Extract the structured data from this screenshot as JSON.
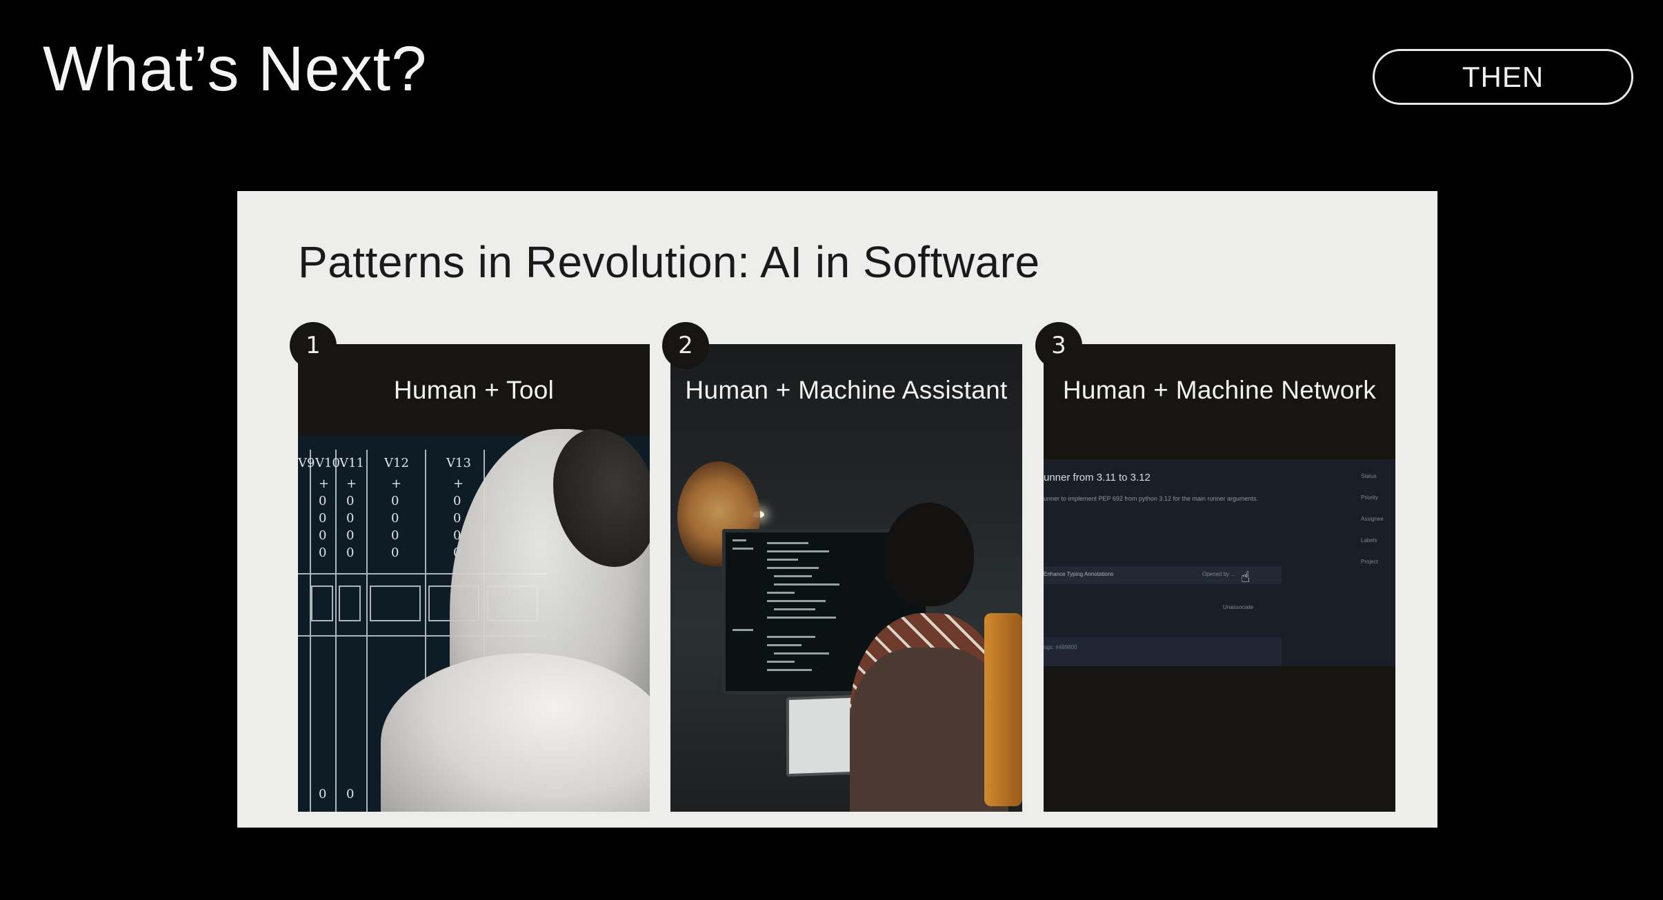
{
  "header": {
    "title": "What’s Next?",
    "pill_label": "THEN"
  },
  "slide": {
    "title": "Patterns in Revolution: AI in Software",
    "cards": [
      {
        "number": "1",
        "label": "Human + Tool"
      },
      {
        "number": "2",
        "label": "Human + Machine Assistant"
      },
      {
        "number": "3",
        "label": "Human + Machine Network"
      }
    ],
    "table_headers": [
      "V9",
      "V10",
      "V11",
      "V12",
      "V13"
    ],
    "app": {
      "title": "unner from 3.11 to 3.12",
      "subtitle": "unner to implement PEP 692 from python 3.12 for the main runner arguments.",
      "row_text": "Enhance Typing Annotations",
      "row_meta": "Opened by  ...",
      "meta2": "Unassociate",
      "bottom_text": "ogs: #489800",
      "side_labels": [
        "Status",
        "Priority",
        "Assignee",
        "Labels",
        "Project"
      ]
    }
  },
  "colors": {
    "background": "#000000",
    "slide_bg": "#ededeb",
    "card_bg": "#171512"
  }
}
